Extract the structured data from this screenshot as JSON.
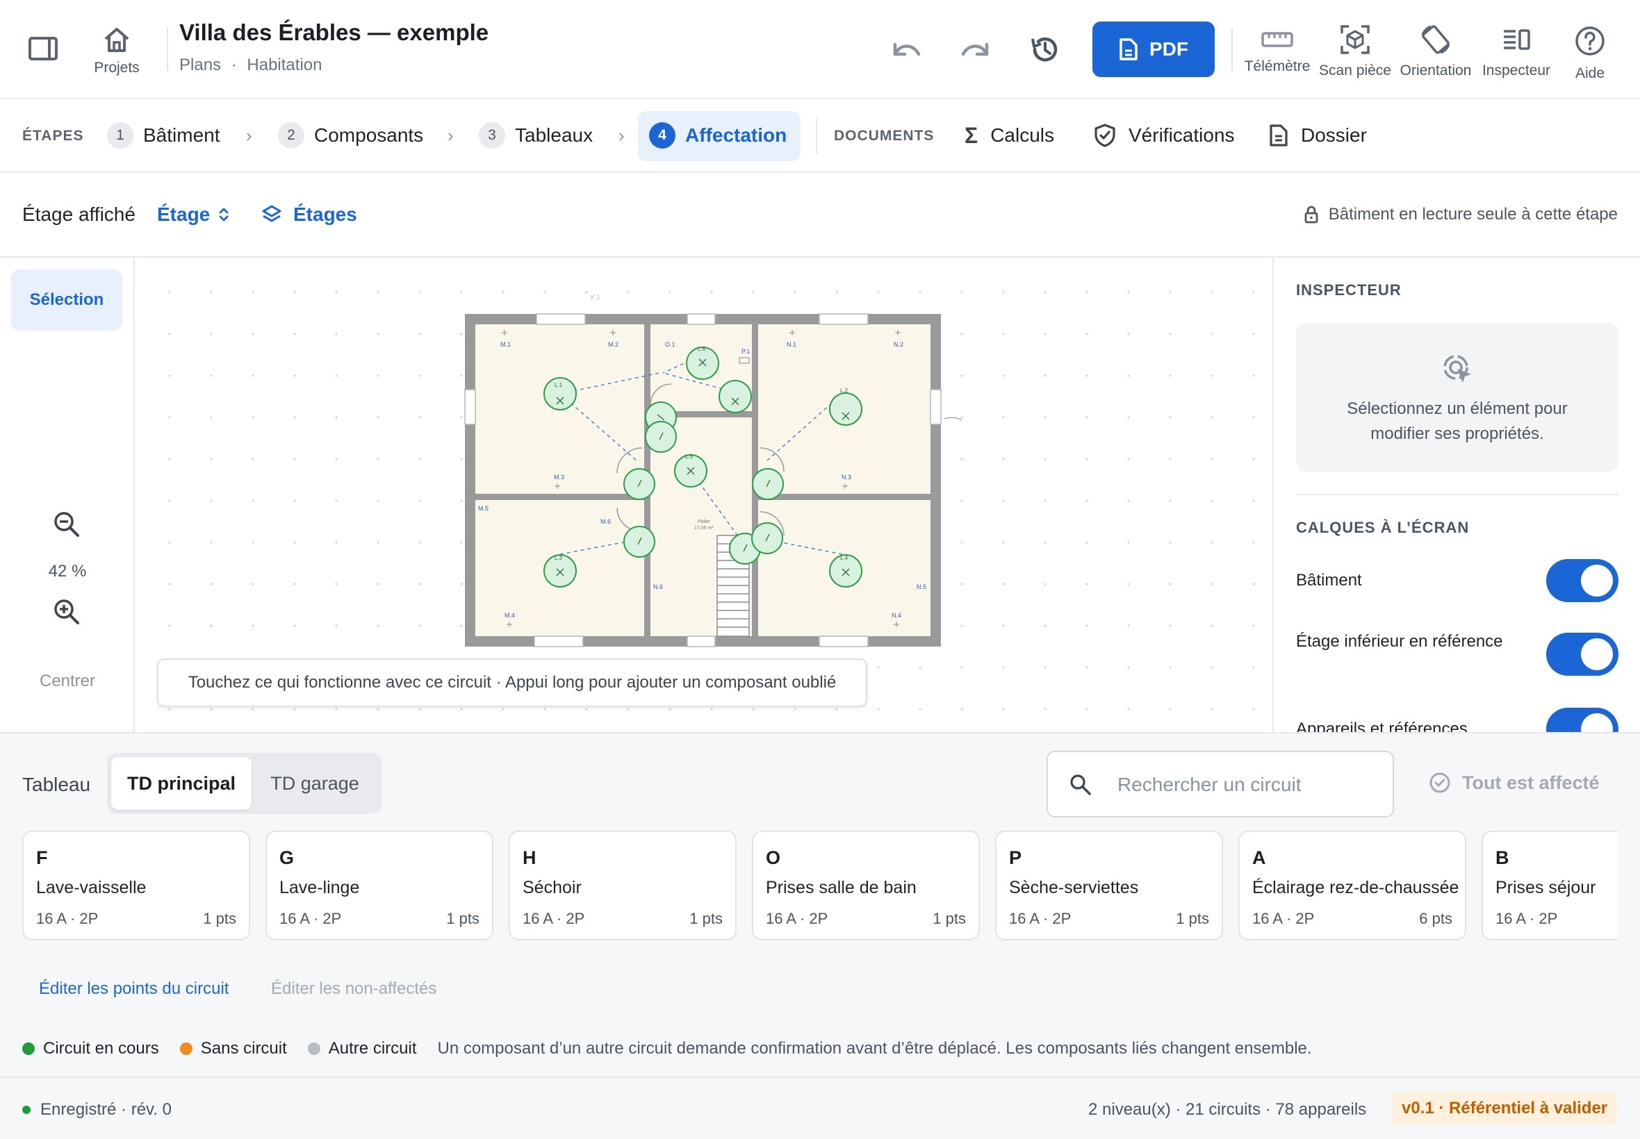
{
  "header": {
    "title": "Villa des Érables — exemple",
    "breadcrumb": [
      "Plans",
      "Habitation"
    ],
    "breadcrumb_sep": "·",
    "projects_label": "Projets",
    "pdf_label": "PDF",
    "tools": [
      {
        "label": "Télémètre",
        "icon": "ruler-icon"
      },
      {
        "label": "Scan pièce",
        "icon": "scan-cube-icon"
      },
      {
        "label": "Orientation",
        "icon": "rotate-device-icon"
      },
      {
        "label": "Inspecteur",
        "icon": "inspector-panel-icon"
      },
      {
        "label": "Aide",
        "icon": "help-icon"
      }
    ]
  },
  "steps": {
    "label": "ÉTAPES",
    "items": [
      {
        "num": "1",
        "label": "Bâtiment"
      },
      {
        "num": "2",
        "label": "Composants"
      },
      {
        "num": "3",
        "label": "Tableaux"
      },
      {
        "num": "4",
        "label": "Affectation",
        "active": true
      }
    ],
    "documents_label": "DOCUMENTS",
    "documents": [
      {
        "label": "Calculs",
        "icon": "sigma-icon"
      },
      {
        "label": "Vérifications",
        "icon": "shield-check-icon"
      },
      {
        "label": "Dossier",
        "icon": "document-icon"
      }
    ]
  },
  "floorbar": {
    "label": "Étage affiché",
    "selected": "Étage",
    "floors_link": "Étages",
    "readonly_note": "Bâtiment en lecture seule à cette étape"
  },
  "tools": {
    "selection": "Sélection",
    "zoom": "42 %",
    "center": "Centrer"
  },
  "plan": {
    "labels": {
      "k1": "K.1",
      "m1": "M.1",
      "m2": "M.2",
      "m3": "M.3",
      "m4": "M.4",
      "m5": "M.5",
      "m6": "M.6",
      "o1": "O.1",
      "p1": "P.1",
      "n1": "N.1",
      "n2": "N.2",
      "n3": "N.3",
      "n4": "N.4",
      "n5": "N.5",
      "n6": "N.6",
      "l1": "L.1",
      "l2": "L.2",
      "l3": "L.3",
      "l4": "L.4",
      "l5": "L.5",
      "l6": "L.6",
      "palier": "Palier",
      "palier_area": "17,06 m²"
    },
    "hint": "Touchez ce qui fonctionne avec ce circuit · Appui long pour ajouter un composant oublié"
  },
  "inspector": {
    "title": "INSPECTEUR",
    "empty_line1": "Sélectionnez un élément pour",
    "empty_line2": "modifier ses propriétés.",
    "layers_title": "CALQUES À L’ÉCRAN",
    "layers": [
      {
        "label": "Bâtiment",
        "on": true
      },
      {
        "label": "Étage inférieur en référence",
        "on": true
      },
      {
        "label": "Appareils et références",
        "on": true
      }
    ]
  },
  "circuits": {
    "board_label": "Tableau",
    "boards": [
      "TD principal",
      "TD garage"
    ],
    "active_board": "TD principal",
    "search_placeholder": "Rechercher un circuit",
    "all_assigned": "Tout est affecté",
    "cards": [
      {
        "letter": "F",
        "name": "Lave-vaisselle",
        "spec": "16 A · 2P",
        "pts": "1 pts"
      },
      {
        "letter": "G",
        "name": "Lave-linge",
        "spec": "16 A · 2P",
        "pts": "1 pts"
      },
      {
        "letter": "H",
        "name": "Séchoir",
        "spec": "16 A · 2P",
        "pts": "1 pts"
      },
      {
        "letter": "O",
        "name": "Prises salle de bain",
        "spec": "16 A · 2P",
        "pts": "1 pts"
      },
      {
        "letter": "P",
        "name": "Sèche-serviettes",
        "spec": "16 A · 2P",
        "pts": "1 pts"
      },
      {
        "letter": "A",
        "name": "Éclairage rez-de-chaussée",
        "spec": "16 A · 2P",
        "pts": "6 pts"
      },
      {
        "letter": "B",
        "name": "Prises séjour",
        "spec": "16 A · 2P",
        "pts": ""
      }
    ],
    "edit_points": "Éditer les points du circuit",
    "edit_unassigned": "Éditer les non-affectés"
  },
  "legend": {
    "items": [
      {
        "label": "Circuit en cours",
        "color": "#1f9d3a"
      },
      {
        "label": "Sans circuit",
        "color": "#f28a1e"
      },
      {
        "label": "Autre circuit",
        "color": "#b8bdc3"
      }
    ],
    "note": "Un composant d’un autre circuit demande confirmation avant d’être déplacé. Les composants liés changent ensemble."
  },
  "status": {
    "saved": "Enregistré · rév. 0",
    "stats": "2 niveau(x) · 21 circuits · 78 appareils",
    "version": "v0.1 · Référentiel à valider"
  },
  "colors": {
    "accent": "#1a66d6",
    "circuit_current": "#1f9d3a",
    "warning_text": "#c25e00"
  }
}
